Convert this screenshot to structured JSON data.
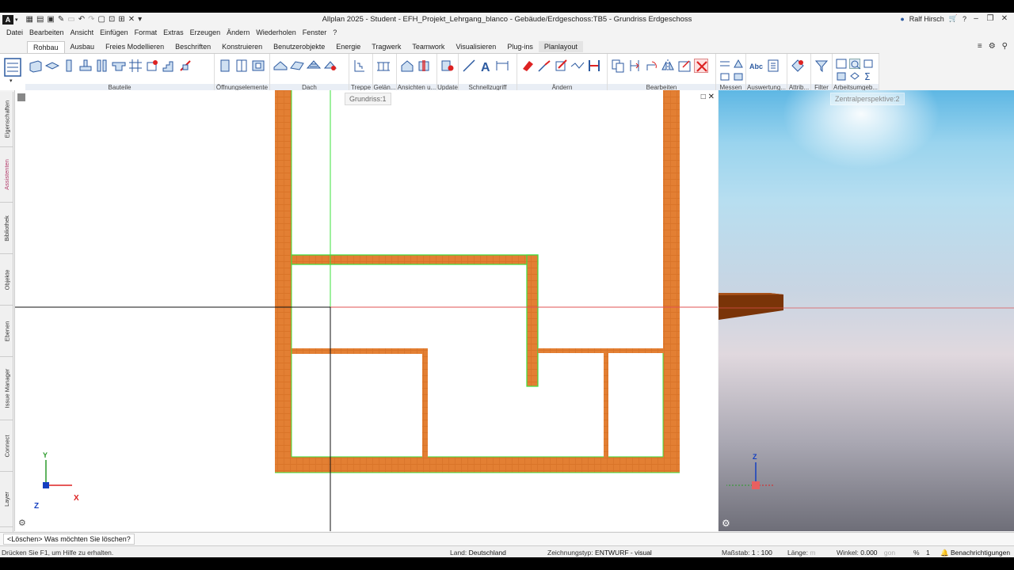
{
  "window": {
    "title": "Allplan 2025 - Student - EFH_Projekt_Lehrgang_blanco - Gebäude/Erdgeschoss:TB5 - Grundriss Erdgeschoss",
    "user": "Ralf Hirsch",
    "logo": "A"
  },
  "menu": [
    "Datei",
    "Bearbeiten",
    "Ansicht",
    "Einfügen",
    "Format",
    "Extras",
    "Erzeugen",
    "Ändern",
    "Wiederholen",
    "Fenster",
    "?"
  ],
  "ribbon_tabs": [
    "Rohbau",
    "Ausbau",
    "Freies Modellieren",
    "Beschriften",
    "Konstruieren",
    "Benutzerobjekte",
    "Energie",
    "Tragwerk",
    "Teamwork",
    "Visualisieren",
    "Plug-ins",
    "Planlayout"
  ],
  "ribbon_groups": [
    "Bauteile",
    "Öffnungselemente",
    "Dach",
    "Treppe",
    "Gelän...",
    "Ansichten u...",
    "Update",
    "Schnellzugriff",
    "Ändern",
    "Bearbeiten",
    "Messen",
    "Auswertung...",
    "Attrib...",
    "Filter",
    "Arbeitsumgeb..."
  ],
  "side_tabs": [
    "Eigenschaften",
    "Assistenten",
    "Bibliothek",
    "Objekte",
    "Ebenen",
    "Issue Manager",
    "Connect",
    "Layer"
  ],
  "viewports": {
    "plan_label": "Grundriss:1",
    "persp_label": "Zentralperspektive:2"
  },
  "axes": {
    "x": "X",
    "y": "Y",
    "z": "Z"
  },
  "command": {
    "prompt": "<Löschen> Was möchten Sie löschen?"
  },
  "status": {
    "help": "Drücken Sie F1, um Hilfe zu erhalten.",
    "land_label": "Land:",
    "land_value": "Deutschland",
    "ztyp_label": "Zeichnungstyp:",
    "ztyp_value": "ENTWURF - visual",
    "scale_label": "Maßstab:",
    "scale_value": "1 : 100",
    "length_label": "Länge:",
    "length_unit": "m",
    "angle_label": "Winkel:",
    "angle_value": "0.000",
    "angle_unit": "gon",
    "percent_label": "%",
    "percent_value": "1",
    "notifications": "Benachrichtigungen"
  },
  "colors": {
    "wall": "#e07a2e",
    "wall_dark": "#c85f1a",
    "highlight": "#3ee03e",
    "accent_tab": "#b23c6b"
  }
}
